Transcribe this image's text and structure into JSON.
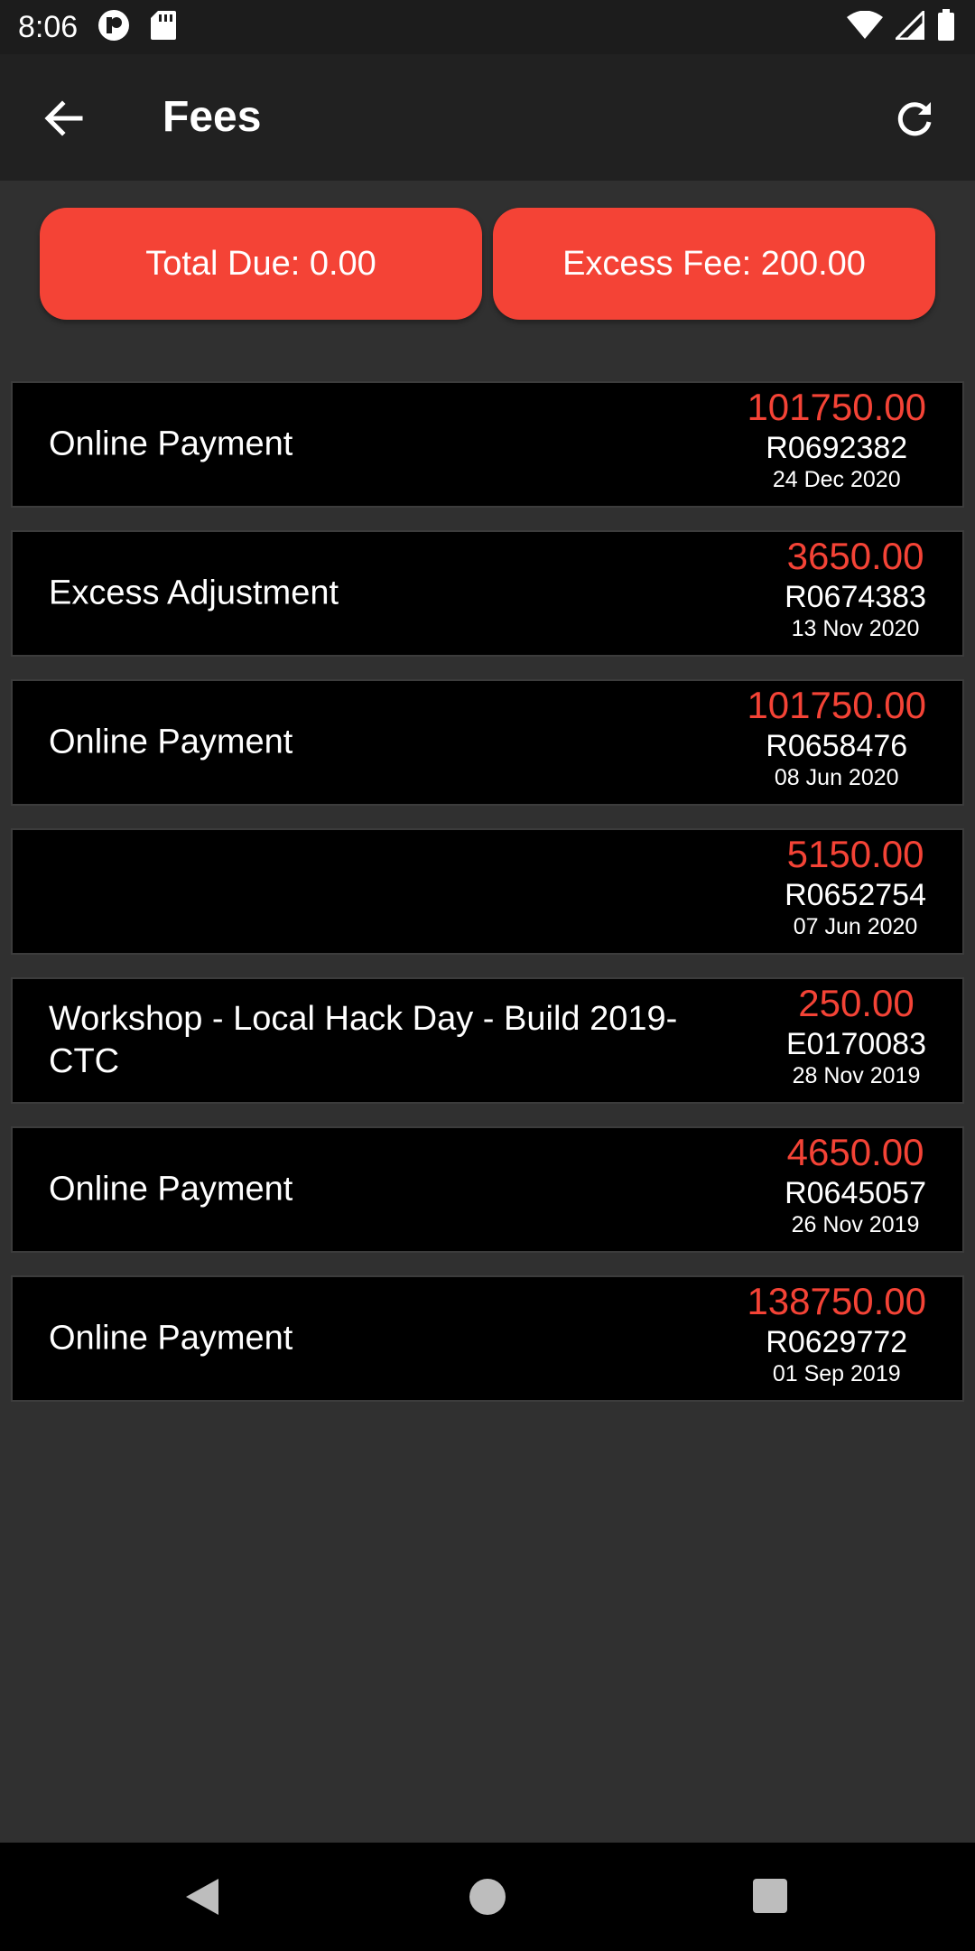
{
  "status_bar": {
    "time": "8:06"
  },
  "app_bar": {
    "title": "Fees"
  },
  "summary": {
    "total_due": "Total Due: 0.00",
    "excess_fee": "Excess Fee: 200.00"
  },
  "transactions": [
    {
      "description": "Online Payment",
      "amount": "101750.00",
      "receipt": "R0692382",
      "date": "24 Dec 2020"
    },
    {
      "description": "Excess Adjustment",
      "amount": "3650.00",
      "receipt": "R0674383",
      "date": "13 Nov 2020"
    },
    {
      "description": "Online Payment",
      "amount": "101750.00",
      "receipt": "R0658476",
      "date": "08 Jun 2020"
    },
    {
      "description": "",
      "amount": "5150.00",
      "receipt": "R0652754",
      "date": "07 Jun 2020"
    },
    {
      "description": "Workshop - Local Hack Day - Build 2019-CTC",
      "amount": "250.00",
      "receipt": "E0170083",
      "date": "28 Nov 2019"
    },
    {
      "description": "Online Payment",
      "amount": "4650.00",
      "receipt": "R0645057",
      "date": "26 Nov 2019"
    },
    {
      "description": "Online Payment",
      "amount": "138750.00",
      "receipt": "R0629772",
      "date": "01 Sep 2019"
    }
  ],
  "colors": {
    "accent": "#f44336",
    "background": "#303030",
    "app_bar": "#212121",
    "card": "#000000"
  },
  "icons": {
    "back": "arrow-left-icon",
    "refresh": "refresh-icon",
    "wifi": "wifi-icon",
    "signal": "signal-icon",
    "battery": "battery-icon",
    "nav_back": "nav-back-icon",
    "nav_home": "nav-home-icon",
    "nav_recent": "nav-recent-icon"
  }
}
